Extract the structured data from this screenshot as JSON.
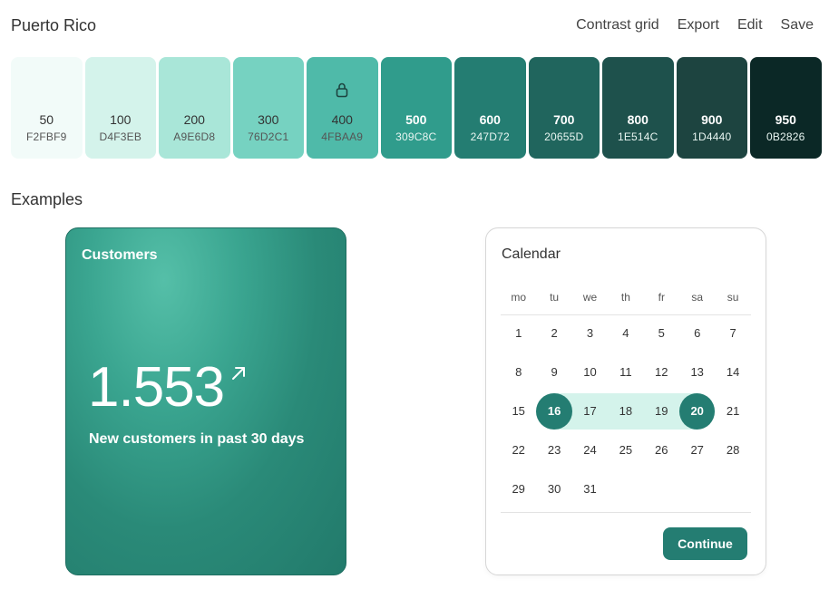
{
  "header": {
    "title": "Puerto Rico",
    "actions": [
      "Contrast grid",
      "Export",
      "Edit",
      "Save"
    ]
  },
  "palette": [
    {
      "shade": "50",
      "hex": "F2FBF9",
      "color": "#F2FBF9",
      "text": "light"
    },
    {
      "shade": "100",
      "hex": "D4F3EB",
      "color": "#D4F3EB",
      "text": "light"
    },
    {
      "shade": "200",
      "hex": "A9E6D8",
      "color": "#A9E6D8",
      "text": "light"
    },
    {
      "shade": "300",
      "hex": "76D2C1",
      "color": "#76D2C1",
      "text": "light"
    },
    {
      "shade": "400",
      "hex": "4FBAA9",
      "color": "#4FBAA9",
      "text": "light",
      "locked": true
    },
    {
      "shade": "500",
      "hex": "309C8C",
      "color": "#309C8C",
      "text": "dark"
    },
    {
      "shade": "600",
      "hex": "247D72",
      "color": "#247D72",
      "text": "dark"
    },
    {
      "shade": "700",
      "hex": "20655D",
      "color": "#20655D",
      "text": "dark"
    },
    {
      "shade": "800",
      "hex": "1E514C",
      "color": "#1E514C",
      "text": "dark"
    },
    {
      "shade": "900",
      "hex": "1D4440",
      "color": "#1D4440",
      "text": "dark"
    },
    {
      "shade": "950",
      "hex": "0B2826",
      "color": "#0B2826",
      "text": "dark"
    }
  ],
  "examples": {
    "title": "Examples",
    "customers": {
      "title": "Customers",
      "value": "1.553",
      "subtitle": "New customers in past 30 days",
      "trend_icon": "arrow-up-right-icon"
    },
    "calendar": {
      "title": "Calendar",
      "weekdays": [
        "mo",
        "tu",
        "we",
        "th",
        "fr",
        "sa",
        "su"
      ],
      "weeks": [
        [
          "1",
          "2",
          "3",
          "4",
          "5",
          "6",
          "7"
        ],
        [
          "8",
          "9",
          "10",
          "11",
          "12",
          "13",
          "14"
        ],
        [
          "15",
          "16",
          "17",
          "18",
          "19",
          "20",
          "21"
        ],
        [
          "22",
          "23",
          "24",
          "25",
          "26",
          "27",
          "28"
        ],
        [
          "29",
          "30",
          "31",
          "",
          "",
          "",
          ""
        ]
      ],
      "range_start": "16",
      "range_end": "20",
      "button": "Continue"
    }
  },
  "colors": {
    "accent": "#247D72",
    "range_bg": "#D4F3EB"
  }
}
